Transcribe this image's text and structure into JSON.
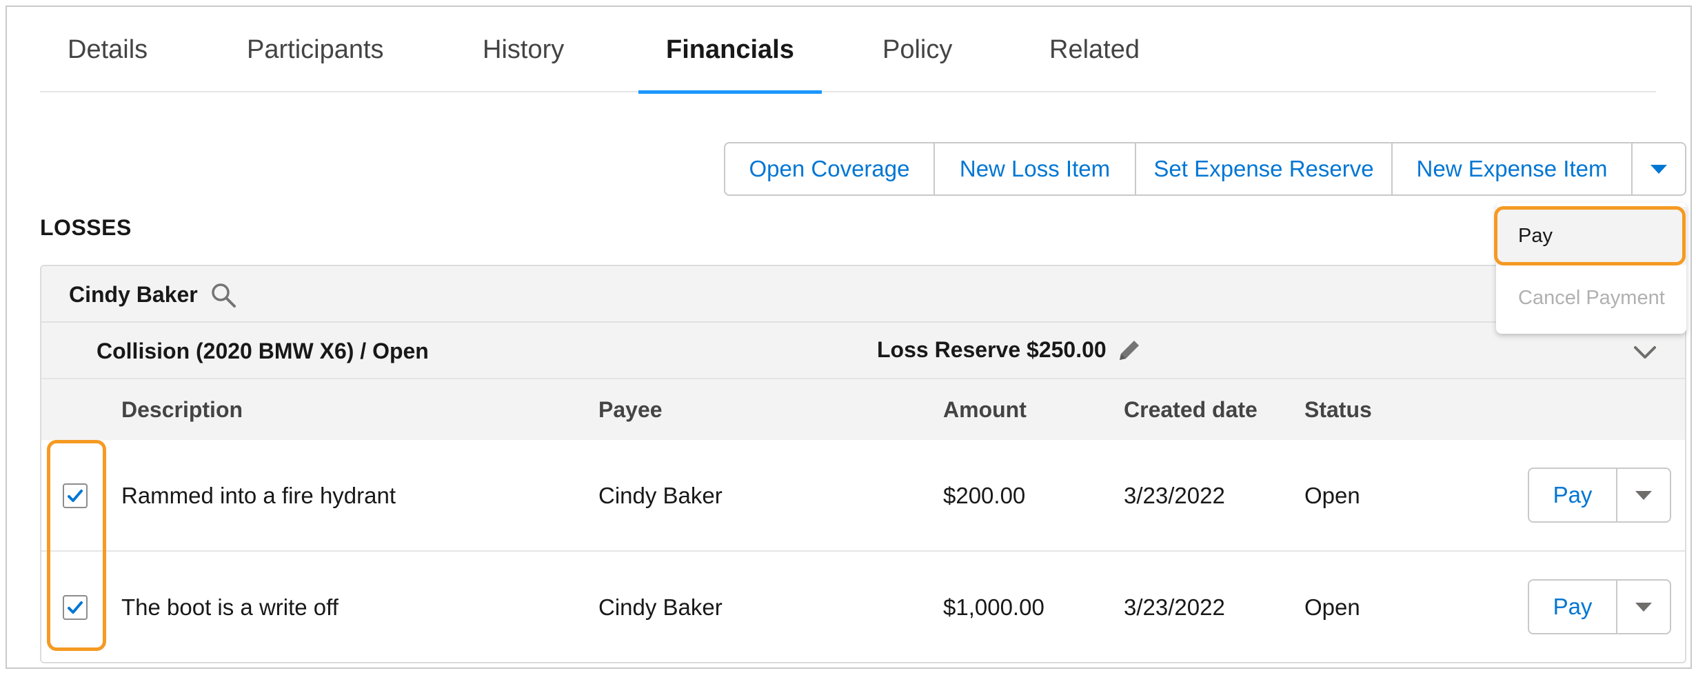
{
  "tabs": [
    {
      "label": "Details"
    },
    {
      "label": "Participants"
    },
    {
      "label": "History"
    },
    {
      "label": "Financials",
      "active": true
    },
    {
      "label": "Policy"
    },
    {
      "label": "Related"
    }
  ],
  "actions": {
    "open_coverage": "Open Coverage",
    "new_loss_item": "New Loss Item",
    "set_expense_reserve": "Set Expense Reserve",
    "new_expense_item": "New Expense Item",
    "more_icon": "chevron-down-icon"
  },
  "dropdown": {
    "items": [
      "Pay",
      "Cancel Payment"
    ],
    "disabled": [
      "Cancel Payment"
    ]
  },
  "section": {
    "title": "LOSSES"
  },
  "claimant": {
    "name": "Cindy Baker",
    "icon": "search-icon"
  },
  "coverage": {
    "title": "Collision (2020 BMW X6) / Open",
    "reserve": "Loss Reserve $250.00",
    "edit_icon": "pencil-icon",
    "collapse_icon": "chevron-down-icon"
  },
  "table": {
    "columns": [
      "Description",
      "Payee",
      "Amount",
      "Created date",
      "Status"
    ],
    "rows": [
      {
        "checked": true,
        "description": "Rammed into a fire hydrant",
        "payee": "Cindy Baker",
        "amount": "$200.00",
        "created": "3/23/2022",
        "status": "Open",
        "action": "Pay"
      },
      {
        "checked": true,
        "description": "The boot is a write off",
        "payee": "Cindy Baker",
        "amount": "$1,000.00",
        "created": "3/23/2022",
        "status": "Open",
        "action": "Pay"
      }
    ]
  },
  "colors": {
    "accent": "#0176d3",
    "tab_indicator": "#1b96ff",
    "highlight": "#f59a23",
    "header_bg": "#f3f3f3"
  }
}
